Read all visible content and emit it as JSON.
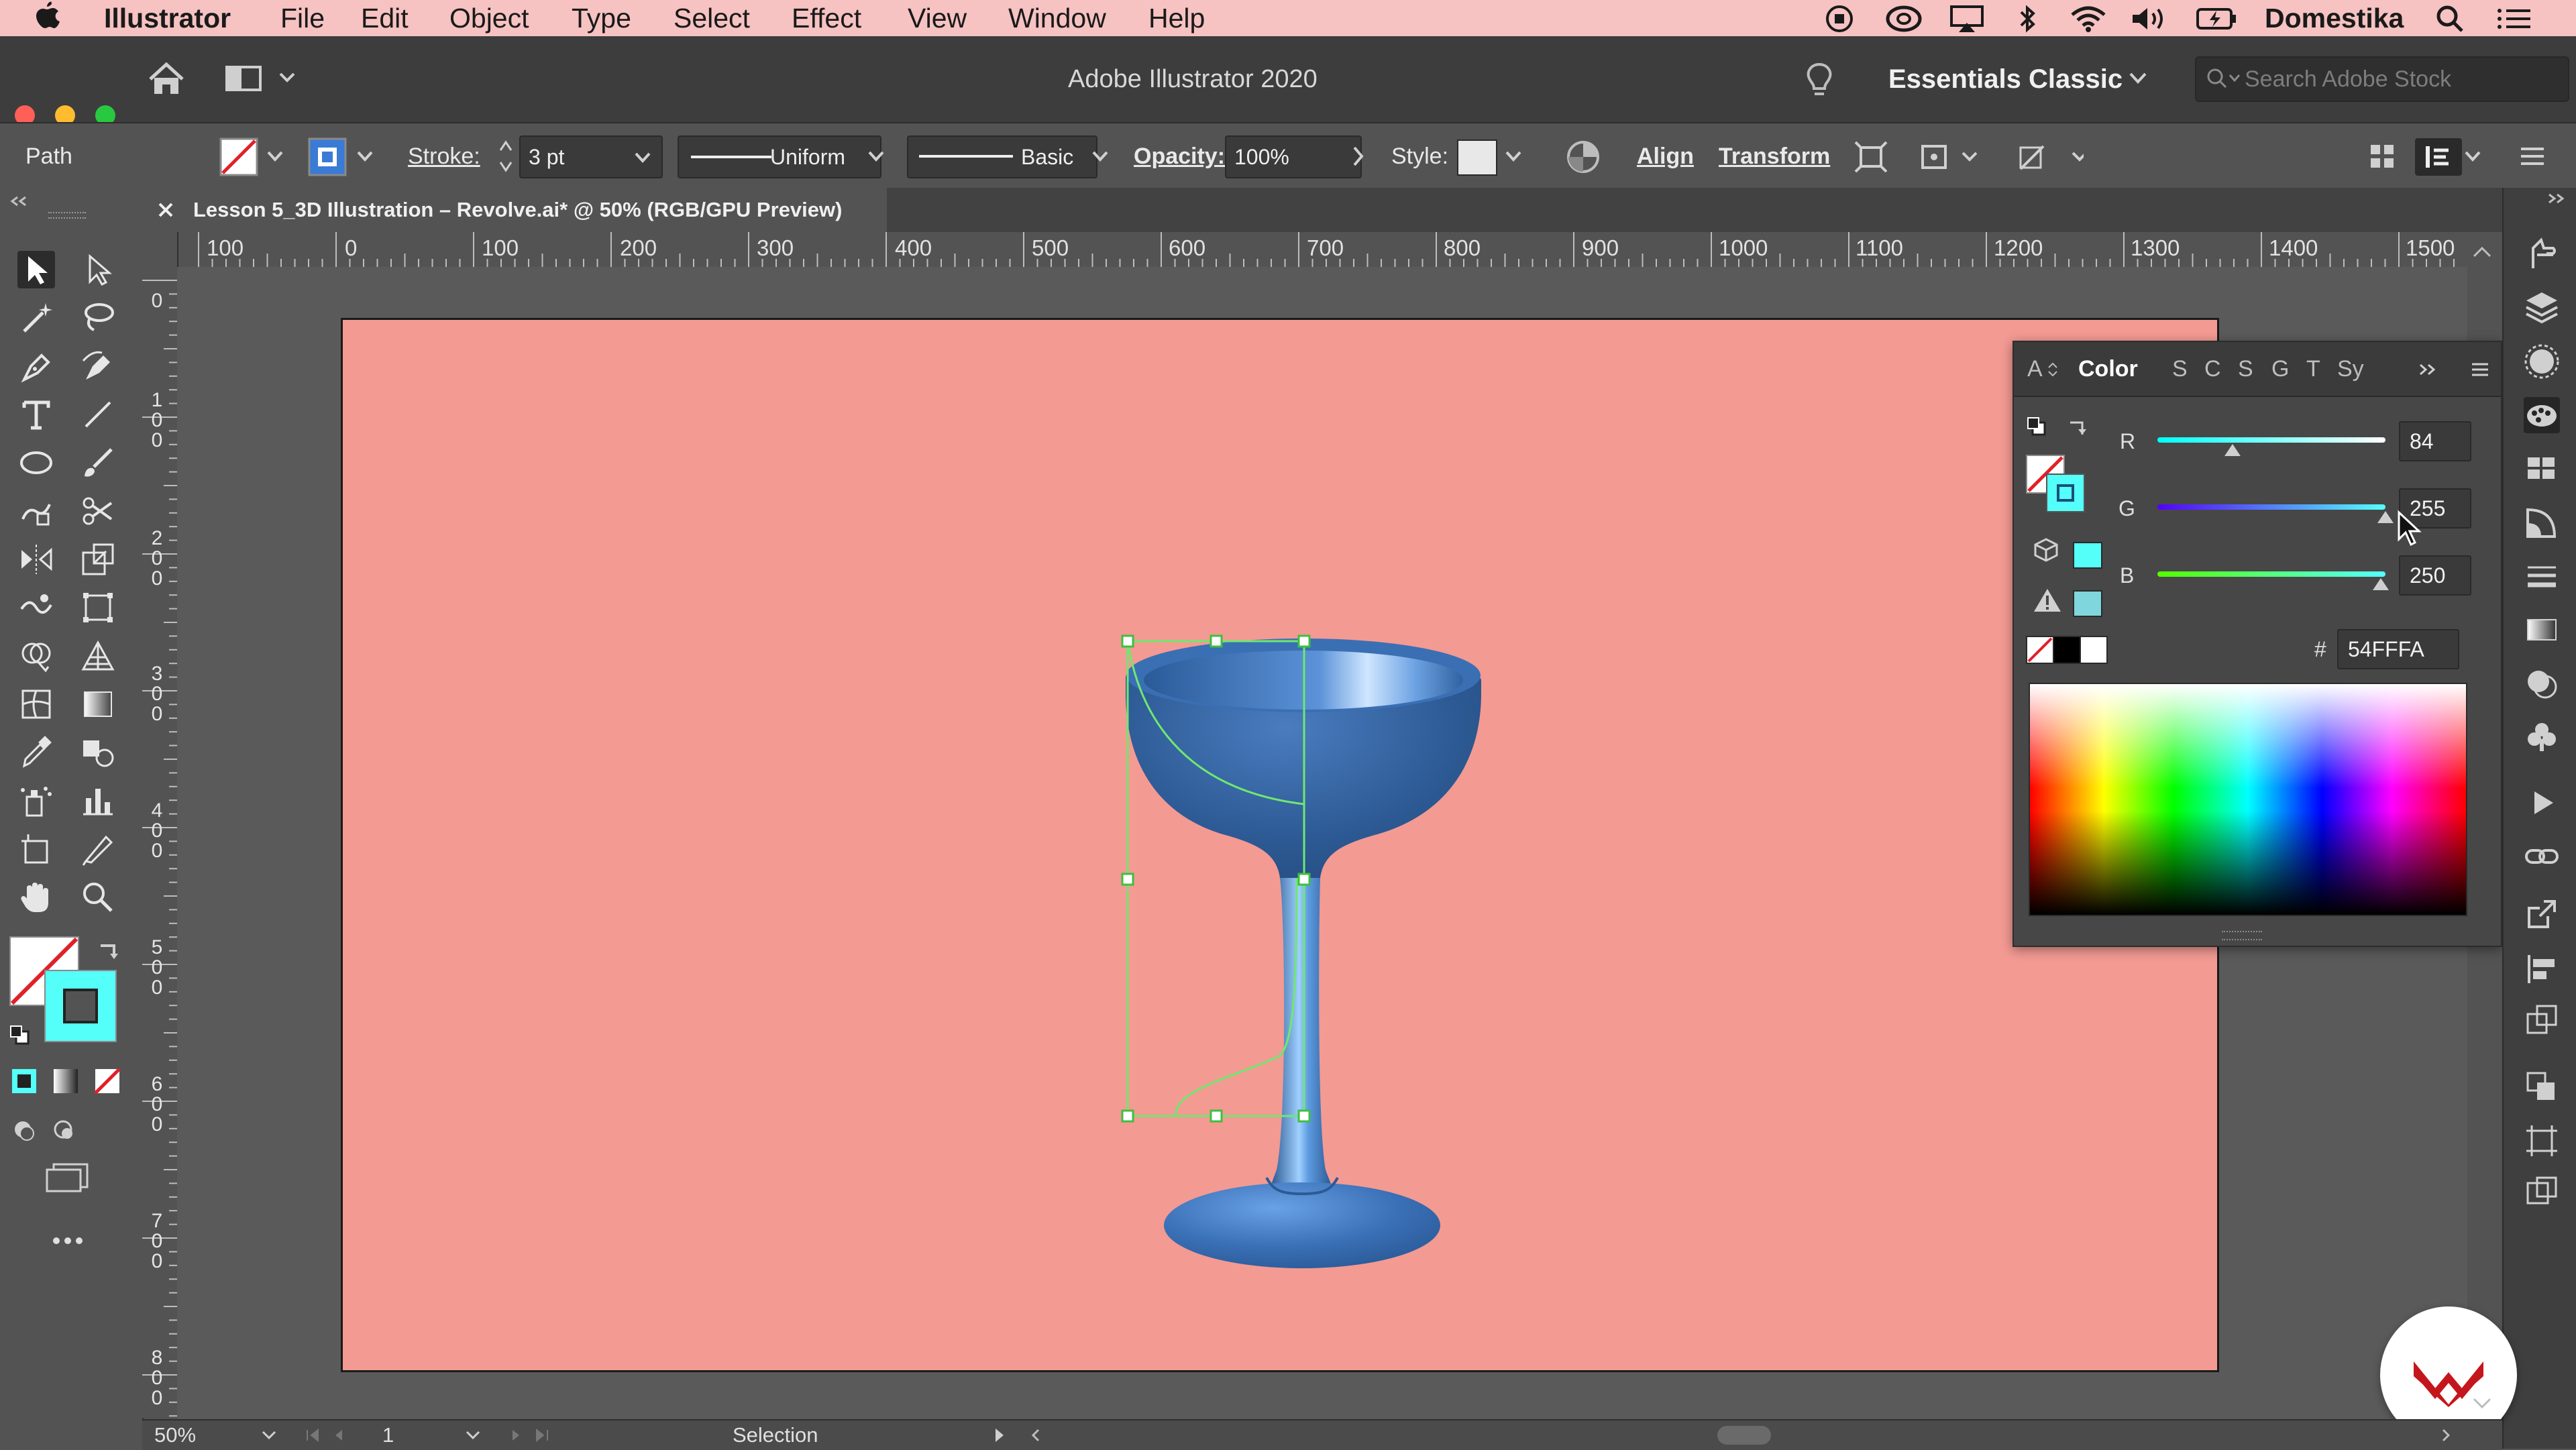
{
  "menubar": {
    "app": "Illustrator",
    "items": [
      "File",
      "Edit",
      "Object",
      "Type",
      "Select",
      "Effect",
      "View",
      "Window",
      "Help"
    ],
    "user": "Domestika"
  },
  "appbar": {
    "title": "Adobe Illustrator 2020",
    "workspace": "Essentials Classic",
    "search_placeholder": "Search Adobe Stock"
  },
  "control": {
    "selection_type": "Path",
    "stroke_label": "Stroke:",
    "stroke_value": "3 pt",
    "profile": "Uniform",
    "brush": "Basic",
    "opacity_label": "Opacity:",
    "opacity_value": "100%",
    "style_label": "Style:",
    "align": "Align",
    "transform": "Transform"
  },
  "document": {
    "tab_title": "Lesson 5_3D Illustration – Revolve.ai* @ 50% (RGB/GPU Preview)"
  },
  "ruler": {
    "h_labels": [
      "100",
      "0",
      "100",
      "200",
      "300",
      "400",
      "500",
      "600",
      "700",
      "800",
      "900",
      "1000",
      "1100",
      "1200",
      "1300",
      "1400",
      "1500"
    ],
    "v_labels": [
      "0",
      "100",
      "200",
      "300",
      "400",
      "500",
      "600",
      "700",
      "800"
    ]
  },
  "color_panel": {
    "tabs": [
      "A",
      "Color",
      "S",
      "C",
      "S",
      "G",
      "T",
      "Sy"
    ],
    "r_label": "R",
    "r_value": "84",
    "r_fraction": 0.329,
    "g_label": "G",
    "g_value": "255",
    "g_fraction": 1.0,
    "b_label": "B",
    "b_value": "250",
    "b_fraction": 0.98,
    "hex_label": "#",
    "hex_value": "54FFFA",
    "fill_color": "#54FFFA"
  },
  "status": {
    "zoom": "50%",
    "page": "1",
    "mode": "Selection"
  },
  "colors": {
    "artboard": "#f39a93",
    "menubar": "#f6c2c2",
    "path_selection": "#6fe86f",
    "glass": "#2f5f9a"
  }
}
